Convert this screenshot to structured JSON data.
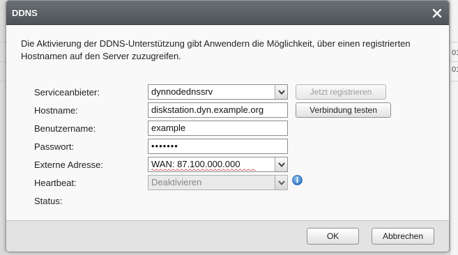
{
  "dialog": {
    "title": "DDNS",
    "description": "Die Aktivierung der DDNS-Unterstützung gibt Anwendern die Möglichkeit, über einen registrierten Hostnamen auf den Server zuzugreifen."
  },
  "form": {
    "provider_label": "Serviceanbieter:",
    "provider_value": "dynnodednssrv",
    "register_button": "Jetzt registrieren",
    "hostname_label": "Hostname:",
    "hostname_value": "diskstation.dyn.example.org",
    "test_button": "Verbindung testen",
    "username_label": "Benutzername:",
    "username_value": "example",
    "password_label": "Passwort:",
    "password_value": "•••••••",
    "external_label": "Externe Adresse:",
    "external_value": "WAN: 87.100.000.000",
    "heartbeat_label": "Heartbeat:",
    "heartbeat_value": "Deaktivieren",
    "status_label": "Status:"
  },
  "footer": {
    "ok_label": "OK",
    "cancel_label": "Abbrechen"
  },
  "background": {
    "peek_texts": [
      "01",
      "01"
    ]
  },
  "colors": {
    "titlebar": "#5c6166",
    "info_icon": "#3a7fc9",
    "spell_squiggle": "#d9534f"
  }
}
